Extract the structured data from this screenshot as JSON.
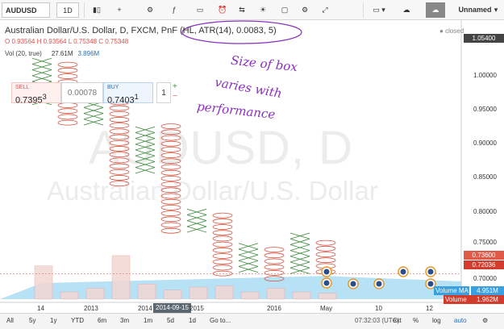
{
  "toolbar": {
    "symbol": "AUDUSD",
    "interval": "1D",
    "layout_name": "Unnamed"
  },
  "legend": {
    "title": "Australian Dollar/U.S. Dollar, D, FXCM, PnF (HL, ATR(14), 0.0083, 5)",
    "ohlc": "O 0.93564 H 0.93564 L 0.75348 C 0.75348",
    "vol_label": "Vol (20, true)",
    "vol_value": "27.61M",
    "vol_ma_value": "3.896M",
    "closed": "closed"
  },
  "trade": {
    "sell_label": "SELL",
    "sell_price": "0.7395",
    "sell_price_sup": "3",
    "spread": "0.00078",
    "buy_label": "BUY",
    "buy_price": "0.7403",
    "buy_price_sup": "1",
    "quantity": "1",
    "plus": "+",
    "minus": "−"
  },
  "watermark": {
    "symbol": "AUDUSD, D",
    "description": "Australian Dollar/U.S. Dollar"
  },
  "annotation": {
    "line1": "Size of box",
    "line2": "varies with",
    "line3": "performance"
  },
  "price_axis": {
    "ticks": [
      "1.00000",
      "0.95000",
      "0.90000",
      "0.85000",
      "0.80000",
      "0.75000",
      "0.70000"
    ],
    "top_badge": "1.05400",
    "last_price_badge": "0.73600",
    "current_badge": "0.72036",
    "vol_ma_label": "Volume MA",
    "vol_ma_value": "4.951M",
    "vol_label": "Volume",
    "vol_value": "1.962M"
  },
  "time_axis": {
    "labels": [
      "14",
      "2013",
      "2014",
      "2014-09-15",
      "2015",
      "2016",
      "May",
      "10",
      "12"
    ],
    "cursor_date": "2014-09-15"
  },
  "bottom_bar": {
    "ranges": [
      "All",
      "5y",
      "1y",
      "YTD",
      "6m",
      "3m",
      "1m",
      "5d",
      "1d"
    ],
    "goto": "Go to...",
    "clock": "07:32:03 (UTC)",
    "ext": "ext",
    "percent": "%",
    "log": "log",
    "auto": "auto"
  },
  "colors": {
    "x_column": "#3a8a3a",
    "o_column": "#d64f3b",
    "volume_bar": "#f3d6d3",
    "volume_area": "#9fd7f2",
    "current_line": "#e07070",
    "last_badge": "#e05a4a",
    "current_badge": "#d23c2c",
    "top_badge": "#444444",
    "vol_ma_badge": "#3aa0e0",
    "vol_badge": "#d23c2c",
    "annotation": "#8a2fc4"
  },
  "chart_data": {
    "type": "point-and-figure",
    "title": "Australian Dollar/U.S. Dollar, D, FXCM, PnF (HL, ATR(14), 0.0083, 5)",
    "box_size": 0.0083,
    "reversal": 5,
    "ylim": [
      0.69,
      1.054
    ],
    "columns": [
      {
        "kind": "X",
        "low": 0.965,
        "high": 1.035
      },
      {
        "kind": "O",
        "low": 0.935,
        "high": 1.03
      },
      {
        "kind": "X",
        "low": 0.94,
        "high": 0.98
      },
      {
        "kind": "O",
        "low": 0.85,
        "high": 0.975
      },
      {
        "kind": "X",
        "low": 0.87,
        "high": 0.935
      },
      {
        "kind": "O",
        "low": 0.775,
        "high": 0.94
      },
      {
        "kind": "X",
        "low": 0.78,
        "high": 0.815
      },
      {
        "kind": "O",
        "low": 0.715,
        "high": 0.81
      },
      {
        "kind": "X",
        "low": 0.725,
        "high": 0.765
      },
      {
        "kind": "O",
        "low": 0.71,
        "high": 0.76
      },
      {
        "kind": "X",
        "low": 0.72,
        "high": 0.78
      },
      {
        "kind": "O",
        "low": 0.72,
        "high": 0.77
      }
    ],
    "volume": [
      0.55,
      0.12,
      0.18,
      0.72,
      0.25,
      0.15,
      0.2,
      0.22,
      0.12,
      0.18,
      0.12,
      0.1
    ]
  }
}
